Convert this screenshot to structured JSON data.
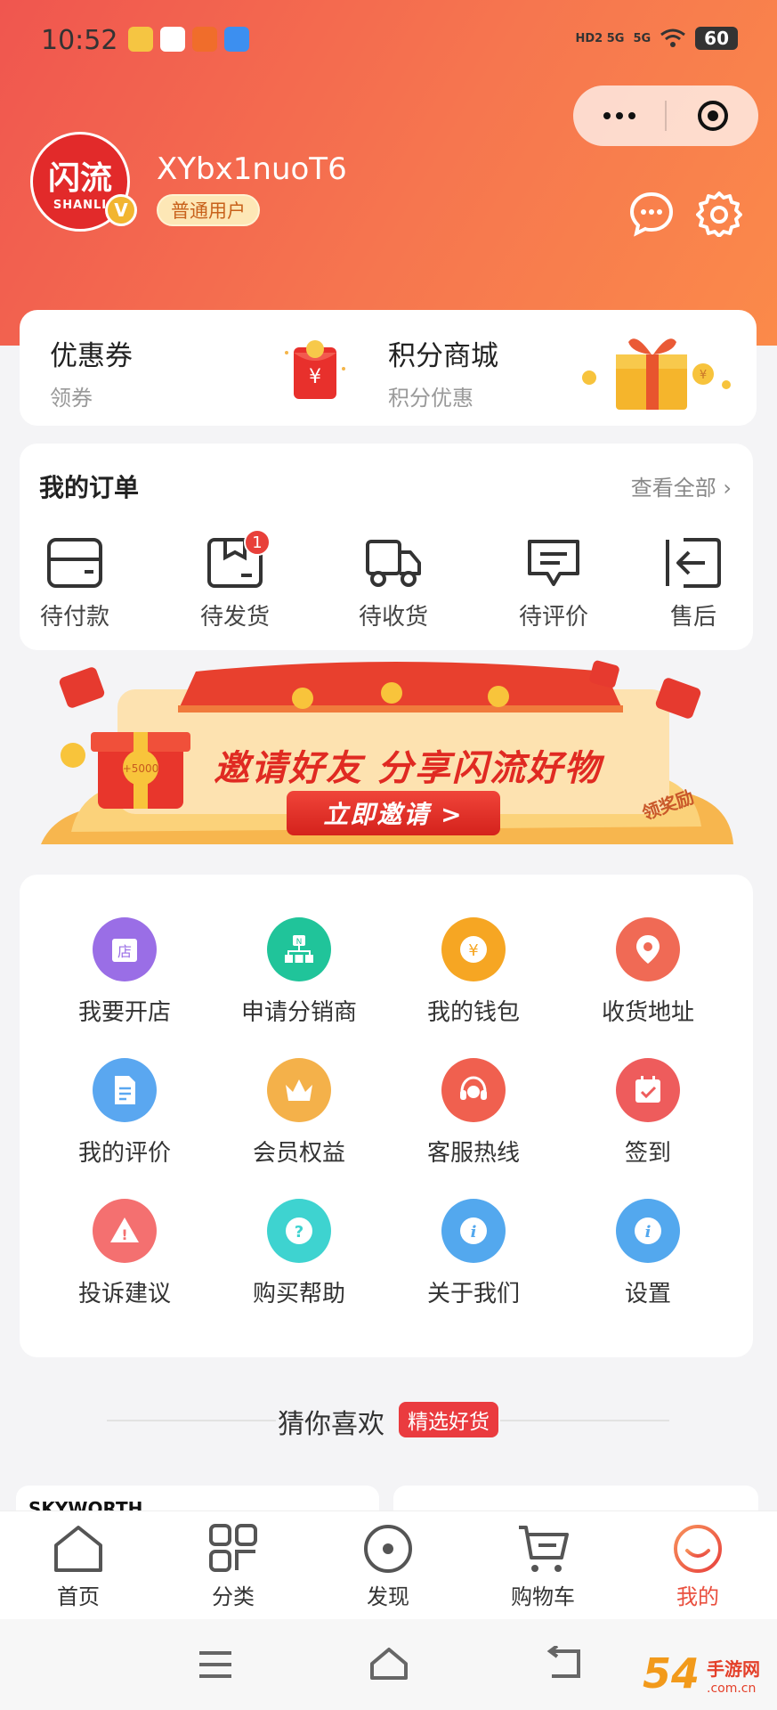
{
  "status_bar": {
    "time": "10:52",
    "signal_1": "HD2 5G",
    "signal_2": "5G",
    "battery": "60"
  },
  "profile": {
    "avatar_logo": "闪流",
    "avatar_sub": "SHANLI",
    "vip_badge": "V",
    "username": "XYbx1nuoT6",
    "user_level": "普通用户"
  },
  "promo": {
    "coupon": {
      "title": "优惠券",
      "subtitle": "领券"
    },
    "points_mall": {
      "title": "积分商城",
      "subtitle": "积分优惠"
    }
  },
  "orders": {
    "title": "我的订单",
    "view_all": "查看全部",
    "items": [
      {
        "label": "待付款",
        "icon": "wallet-icon"
      },
      {
        "label": "待发货",
        "icon": "box-icon",
        "badge": "1"
      },
      {
        "label": "待收货",
        "icon": "truck-icon"
      },
      {
        "label": "待评价",
        "icon": "comment-icon"
      },
      {
        "label": "售后",
        "icon": "return-icon"
      }
    ]
  },
  "banner": {
    "headline": "邀请好友  分享闪流好物",
    "button": "立即邀请 >",
    "reward_tag": "领奖励",
    "gift_value": "+5000"
  },
  "services": [
    {
      "label": "我要开店",
      "icon": "shop-icon",
      "color": "#9a6ee6",
      "glyph": "店"
    },
    {
      "label": "申请分销商",
      "icon": "distributor-icon",
      "color": "#20c49a",
      "glyph": "N"
    },
    {
      "label": "我的钱包",
      "icon": "wallet-yen-icon",
      "color": "#f6a623",
      "glyph": "¥"
    },
    {
      "label": "收货地址",
      "icon": "location-icon",
      "color": "#f06a55",
      "glyph": ""
    },
    {
      "label": "我的评价",
      "icon": "document-icon",
      "color": "#5aa7f0",
      "glyph": ""
    },
    {
      "label": "会员权益",
      "icon": "crown-icon",
      "color": "#f4b14a",
      "glyph": ""
    },
    {
      "label": "客服热线",
      "icon": "headset-icon",
      "color": "#f0604f",
      "glyph": ""
    },
    {
      "label": "签到",
      "icon": "calendar-check-icon",
      "color": "#ee5c5c",
      "glyph": ""
    },
    {
      "label": "投诉建议",
      "icon": "warning-icon",
      "color": "#f47070",
      "glyph": "!"
    },
    {
      "label": "购买帮助",
      "icon": "help-icon",
      "color": "#3ed3d0",
      "glyph": "?"
    },
    {
      "label": "关于我们",
      "icon": "info-icon",
      "color": "#53a8ee",
      "glyph": "i"
    },
    {
      "label": "设置",
      "icon": "settings-info-icon",
      "color": "#53a8ee",
      "glyph": "i"
    }
  ],
  "guess": {
    "title": "猜你喜欢",
    "tag": "精选好货",
    "first_product_brand": "SKYWORTH"
  },
  "tabbar": [
    {
      "label": "首页",
      "icon": "home-icon"
    },
    {
      "label": "分类",
      "icon": "category-icon"
    },
    {
      "label": "发现",
      "icon": "discover-icon"
    },
    {
      "label": "购物车",
      "icon": "cart-icon"
    },
    {
      "label": "我的",
      "icon": "profile-icon",
      "active": true
    }
  ],
  "watermark": {
    "main": "54",
    "text": "手游网",
    "url": ".com.cn"
  },
  "colors": {
    "brand_red": "#e94f3e",
    "header_gradient_start": "#f0564f",
    "header_gradient_end": "#fb8a4a",
    "badge_red": "#e8403a"
  }
}
